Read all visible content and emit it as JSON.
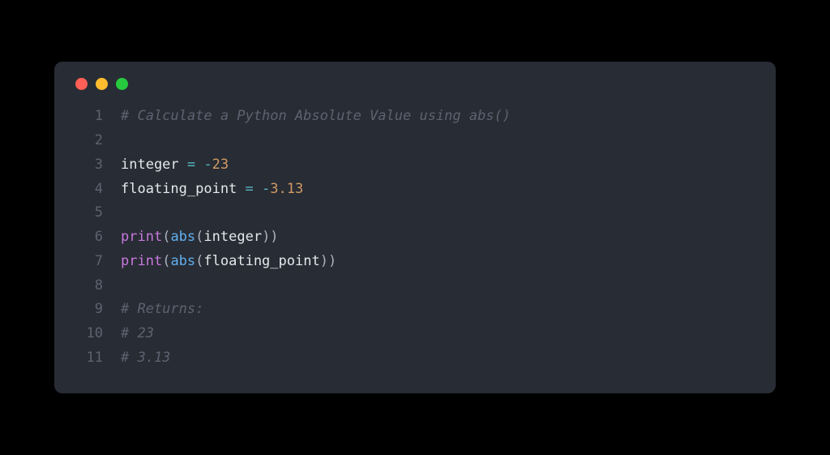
{
  "window": {
    "traffic_lights": [
      "red",
      "yellow",
      "green"
    ]
  },
  "code": {
    "lines": [
      {
        "num": "1",
        "tokens": [
          {
            "cls": "tk-comment",
            "t": "# Calculate a Python Absolute Value using abs()"
          }
        ]
      },
      {
        "num": "2",
        "tokens": []
      },
      {
        "num": "3",
        "tokens": [
          {
            "cls": "tk-var",
            "t": "integer "
          },
          {
            "cls": "tk-op",
            "t": "="
          },
          {
            "cls": "tk-var",
            "t": " "
          },
          {
            "cls": "tk-op",
            "t": "-"
          },
          {
            "cls": "tk-num",
            "t": "23"
          }
        ]
      },
      {
        "num": "4",
        "tokens": [
          {
            "cls": "tk-var",
            "t": "floating_point "
          },
          {
            "cls": "tk-op",
            "t": "="
          },
          {
            "cls": "tk-var",
            "t": " "
          },
          {
            "cls": "tk-op",
            "t": "-"
          },
          {
            "cls": "tk-num",
            "t": "3.13"
          }
        ]
      },
      {
        "num": "5",
        "tokens": []
      },
      {
        "num": "6",
        "tokens": [
          {
            "cls": "tk-builtin",
            "t": "print"
          },
          {
            "cls": "tk-punct",
            "t": "("
          },
          {
            "cls": "tk-func",
            "t": "abs"
          },
          {
            "cls": "tk-punct",
            "t": "("
          },
          {
            "cls": "tk-var",
            "t": "integer"
          },
          {
            "cls": "tk-punct",
            "t": "))"
          }
        ]
      },
      {
        "num": "7",
        "tokens": [
          {
            "cls": "tk-builtin",
            "t": "print"
          },
          {
            "cls": "tk-punct",
            "t": "("
          },
          {
            "cls": "tk-func",
            "t": "abs"
          },
          {
            "cls": "tk-punct",
            "t": "("
          },
          {
            "cls": "tk-var",
            "t": "floating_point"
          },
          {
            "cls": "tk-punct",
            "t": "))"
          }
        ]
      },
      {
        "num": "8",
        "tokens": []
      },
      {
        "num": "9",
        "tokens": [
          {
            "cls": "tk-comment",
            "t": "# Returns:"
          }
        ]
      },
      {
        "num": "10",
        "tokens": [
          {
            "cls": "tk-comment",
            "t": "# 23"
          }
        ]
      },
      {
        "num": "11",
        "tokens": [
          {
            "cls": "tk-comment",
            "t": "# 3.13"
          }
        ]
      }
    ]
  }
}
